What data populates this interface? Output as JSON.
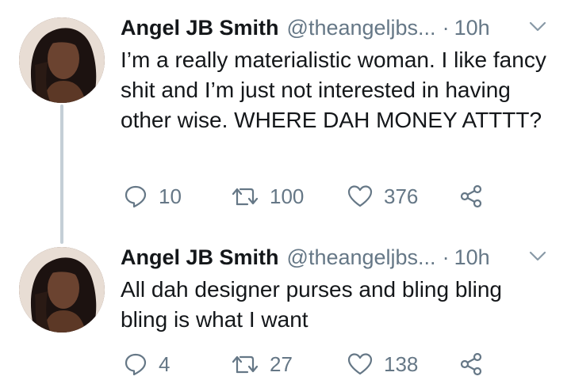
{
  "tweets": [
    {
      "author_name": "Angel JB Smith",
      "handle": "@theangeljbs...",
      "separator": "·",
      "time": "10h",
      "text": "I’m a really materialistic woman. I like fancy shit and I’m just not interested in having other wise. WHERE DAH MONEY ATTTT?",
      "replies": "10",
      "retweets": "100",
      "likes": "376"
    },
    {
      "author_name": "Angel JB Smith",
      "handle": "@theangeljbs...",
      "separator": "·",
      "time": "10h",
      "text": "All dah designer purses and bling bling bling is what I want",
      "replies": "4",
      "retweets": "27",
      "likes": "138"
    }
  ],
  "icons": {
    "reply": "reply-icon",
    "retweet": "retweet-icon",
    "like": "heart-icon",
    "share": "share-icon",
    "caret": "chevron-down-icon"
  },
  "colors": {
    "text": "#14171a",
    "secondary": "#657786",
    "thread_line": "#c4cfd6",
    "background": "#ffffff"
  }
}
